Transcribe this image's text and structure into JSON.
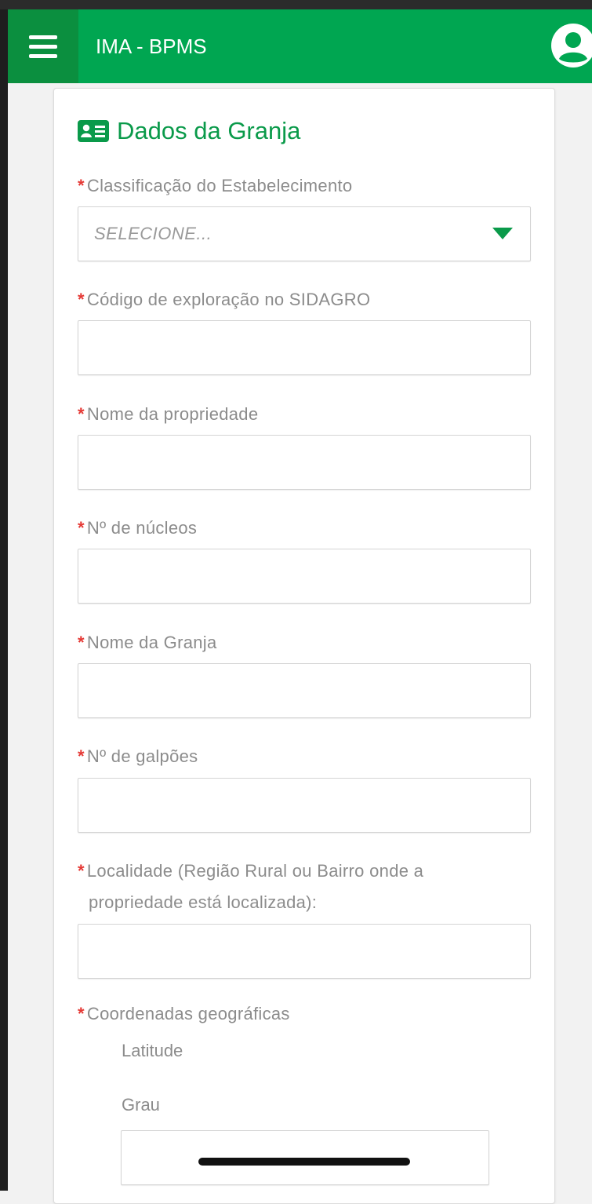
{
  "app": {
    "title": "IMA - BPMS"
  },
  "card": {
    "title": "Dados da Granja"
  },
  "form": {
    "required_mark": "*",
    "classificacao": {
      "label": "Classificação do Estabelecimento",
      "placeholder": "SELECIONE..."
    },
    "codigo": {
      "label": "Código de exploração no SIDAGRO",
      "value": ""
    },
    "nome_propriedade": {
      "label": "Nome da propriedade",
      "value": ""
    },
    "nucleos": {
      "label": "Nº de núcleos",
      "value": ""
    },
    "nome_granja": {
      "label": "Nome da Granja",
      "value": ""
    },
    "galpoes": {
      "label": "Nº de galpões",
      "value": ""
    },
    "localidade": {
      "label_line1": "Localidade (Região Rural ou Bairro onde a",
      "label_line2": "propriedade está localizada):",
      "value": ""
    },
    "coordenadas": {
      "label": "Coordenadas geográficas",
      "latitude_label": "Latitude",
      "grau_label": "Grau",
      "grau_value": ""
    }
  },
  "icons": {
    "menu": "hamburger-menu-icon",
    "user": "user-circle-icon",
    "card": "id-card-icon",
    "dropdown": "caret-down-icon"
  },
  "colors": {
    "primary": "#00a651",
    "primary_dark": "#0b8f3f",
    "required": "#e53935"
  }
}
